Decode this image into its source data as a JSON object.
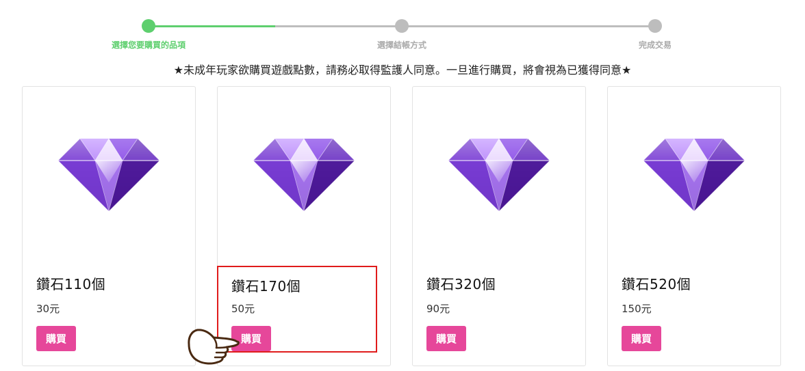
{
  "stepper": {
    "steps": [
      {
        "label": "選擇您要購買的品項",
        "state": "active"
      },
      {
        "label": "選擇結帳方式",
        "state": "pending"
      },
      {
        "label": "完成交易",
        "state": "pending"
      }
    ]
  },
  "notice": "★未成年玩家欲購買遊戲點數，請務必取得監護人同意。一旦進行購買，將會視為已獲得同意★",
  "products": [
    {
      "name": "鑽石110個",
      "price": "30元",
      "buy_label": "購買",
      "icon": "diamond-icon"
    },
    {
      "name": "鑽石170個",
      "price": "50元",
      "buy_label": "購買",
      "icon": "diamond-icon",
      "highlighted": true
    },
    {
      "name": "鑽石320個",
      "price": "90元",
      "buy_label": "購買",
      "icon": "diamond-icon"
    },
    {
      "name": "鑽石520個",
      "price": "150元",
      "buy_label": "購買",
      "icon": "diamond-icon"
    }
  ],
  "pointer": {
    "icon": "pointing-hand-icon"
  },
  "colors": {
    "step_active": "#5ecf6e",
    "step_pending": "#bdbdbd",
    "step_active_label": "#5ecf6e",
    "step_pending_label": "#aaaaaa",
    "buy_button": "#e6479a",
    "highlight_border": "#e01b1b"
  }
}
